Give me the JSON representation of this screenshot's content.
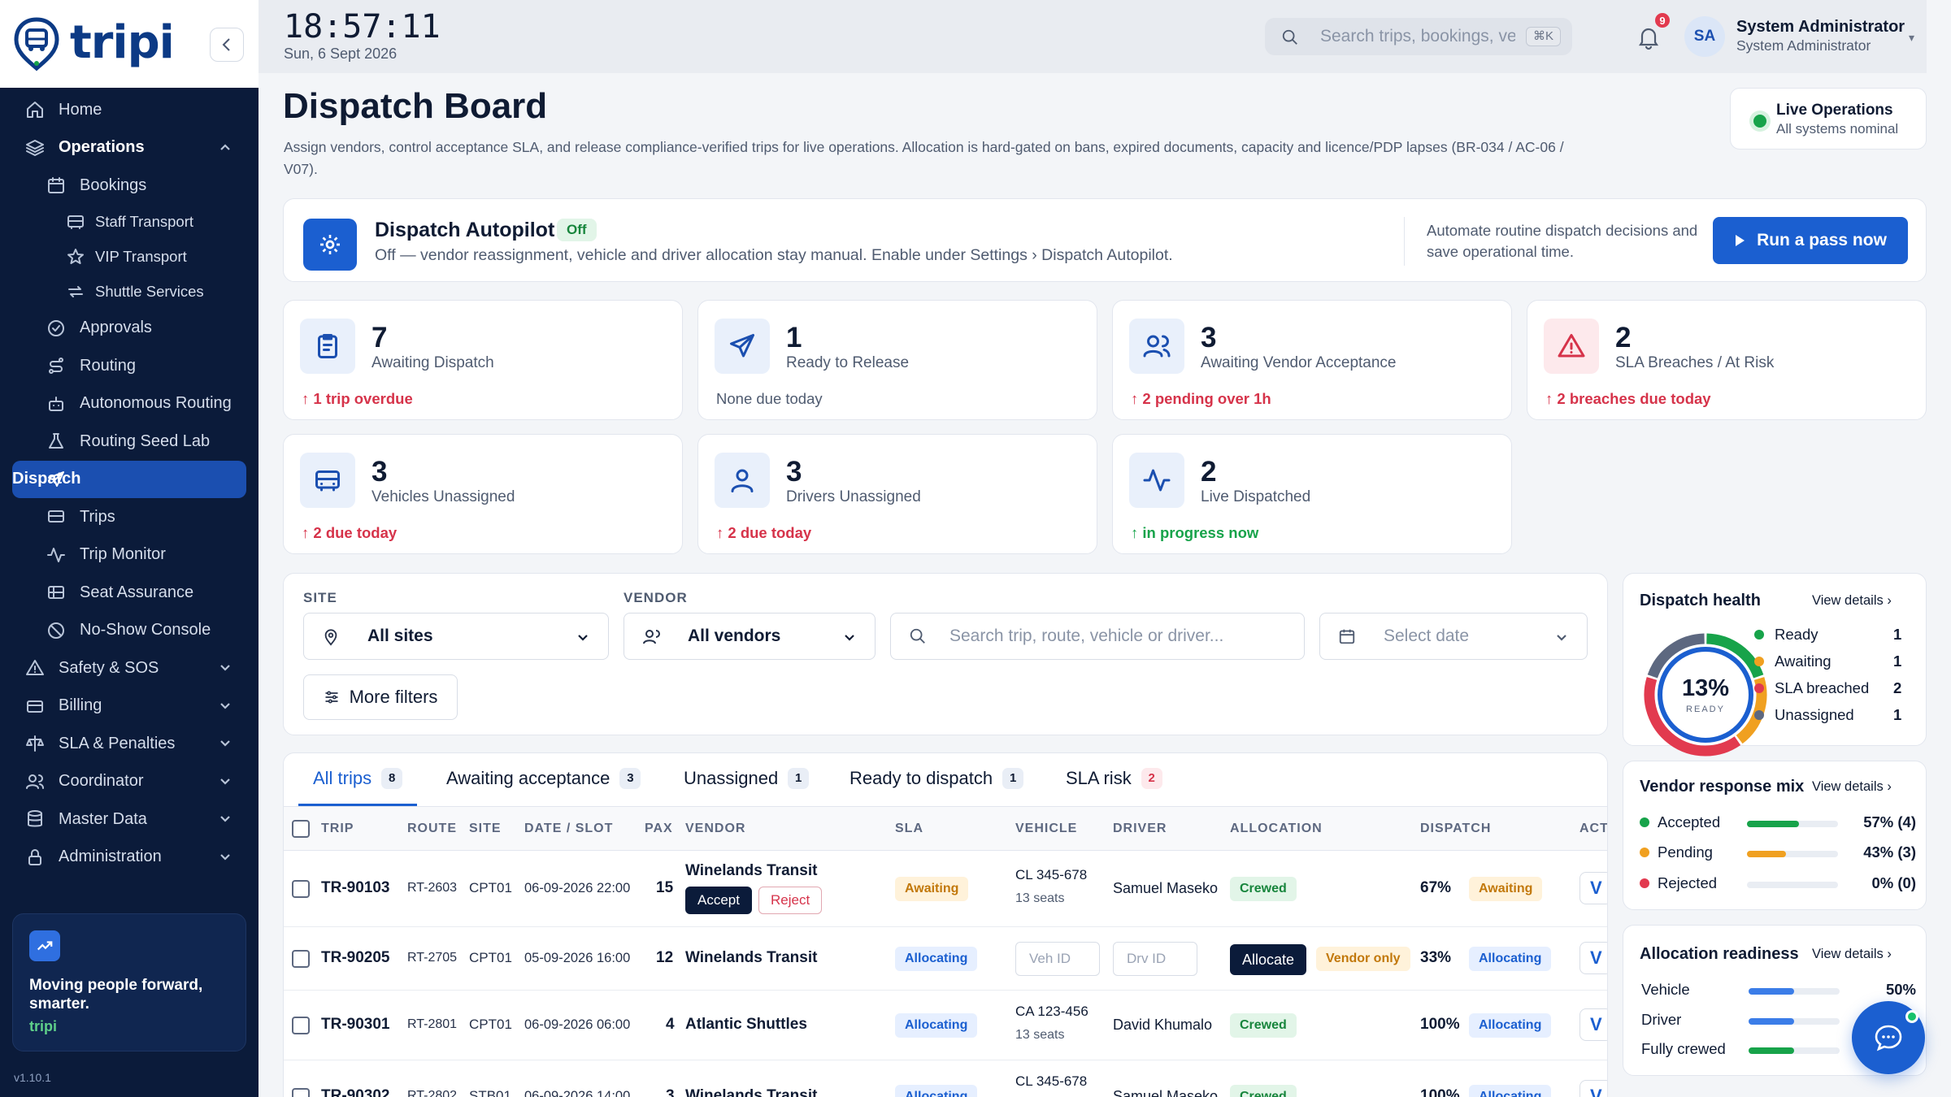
{
  "brand": {
    "name": "tripi"
  },
  "sidebar": {
    "items": [
      {
        "label": "Home",
        "icon": "home-icon"
      },
      {
        "label": "Operations",
        "icon": "layers-icon"
      },
      {
        "label": "Bookings",
        "icon": "calendar-icon"
      },
      {
        "label": "Staff Transport",
        "icon": "bus-icon"
      },
      {
        "label": "VIP Transport",
        "icon": "star-icon"
      },
      {
        "label": "Shuttle Services",
        "icon": "repeat-icon"
      },
      {
        "label": "Approvals",
        "icon": "check-circle-icon"
      },
      {
        "label": "Routing",
        "icon": "route-icon"
      },
      {
        "label": "Autonomous Routing",
        "icon": "robot-icon"
      },
      {
        "label": "Routing Seed Lab",
        "icon": "flask-icon"
      },
      {
        "label": "Dispatch",
        "icon": "send-icon"
      },
      {
        "label": "Trips",
        "icon": "bus-icon"
      },
      {
        "label": "Trip Monitor",
        "icon": "activity-icon"
      },
      {
        "label": "Seat Assurance",
        "icon": "seat-icon"
      },
      {
        "label": "No-Show Console",
        "icon": "ban-icon"
      },
      {
        "label": "Safety & SOS",
        "icon": "warning-icon"
      },
      {
        "label": "Billing",
        "icon": "credit-card-icon"
      },
      {
        "label": "SLA & Penalties",
        "icon": "scale-icon"
      },
      {
        "label": "Coordinator",
        "icon": "users-icon"
      },
      {
        "label": "Master Data",
        "icon": "database-icon"
      },
      {
        "label": "Administration",
        "icon": "lock-icon"
      }
    ],
    "promo": {
      "text": "Moving people forward, smarter.",
      "brand": "tripi"
    },
    "version": "v1.10.1"
  },
  "topbar": {
    "time": "18:57:11",
    "date": "Sun, 6 Sept 2026",
    "search_placeholder": "Search trips, bookings, vehicles",
    "shortcut": "⌘K",
    "notifications": "9",
    "avatar": "SA",
    "user_name": "System Administrator",
    "user_role": "System Administrator"
  },
  "page": {
    "title": "Dispatch Board",
    "subtitle": "Assign vendors, control acceptance SLA, and release compliance-verified trips for live operations. Allocation is hard-gated on bans, expired documents, capacity and licence/PDP lapses (BR-034 / AC-06 / V07).",
    "live_title": "Live Operations",
    "live_sub": "All systems nominal"
  },
  "autopilot": {
    "title": "Dispatch Autopilot",
    "badge": "Off",
    "sub": "Off — vendor reassignment, vehicle and driver allocation stay manual. Enable under Settings › Dispatch Autopilot.",
    "hint": "Automate routine dispatch decisions and save operational time.",
    "button": "Run a pass now"
  },
  "kpis": [
    {
      "value": "7",
      "label": "Awaiting Dispatch",
      "foot": "1 trip overdue",
      "tone": "red",
      "arrow": "↑",
      "icon": "clipboard-icon"
    },
    {
      "value": "1",
      "label": "Ready to Release",
      "foot": "None due today",
      "tone": "grey",
      "arrow": "",
      "icon": "send-icon"
    },
    {
      "value": "3",
      "label": "Awaiting Vendor Acceptance",
      "foot": "2 pending over 1h",
      "tone": "red",
      "arrow": "↑",
      "icon": "users-icon"
    },
    {
      "value": "2",
      "label": "SLA Breaches / At Risk",
      "foot": "2 breaches due today",
      "tone": "red",
      "arrow": "↑",
      "icon": "warning-icon"
    },
    {
      "value": "3",
      "label": "Vehicles Unassigned",
      "foot": "2 due today",
      "tone": "red",
      "arrow": "↑",
      "icon": "bus-icon"
    },
    {
      "value": "3",
      "label": "Drivers Unassigned",
      "foot": "2 due today",
      "tone": "red",
      "arrow": "↑",
      "icon": "user-icon"
    },
    {
      "value": "2",
      "label": "Live Dispatched",
      "foot": "in progress now",
      "tone": "green",
      "arrow": "↑",
      "icon": "activity-icon"
    }
  ],
  "filters": {
    "site_label": "SITE",
    "site_value": "All sites",
    "vendor_label": "VENDOR",
    "vendor_value": "All vendors",
    "search_placeholder": "Search trip, route, vehicle or driver...",
    "date_placeholder": "Select date",
    "more": "More filters"
  },
  "tabs": [
    {
      "label": "All trips",
      "count": "8"
    },
    {
      "label": "Awaiting acceptance",
      "count": "3"
    },
    {
      "label": "Unassigned",
      "count": "1"
    },
    {
      "label": "Ready to dispatch",
      "count": "1"
    },
    {
      "label": "SLA risk",
      "count": "2"
    }
  ],
  "table": {
    "headers": [
      "TRIP",
      "ROUTE",
      "SITE",
      "DATE / SLOT",
      "PAX",
      "VENDOR",
      "SLA",
      "VEHICLE",
      "DRIVER",
      "ALLOCATION",
      "DISPATCH",
      "ACT"
    ],
    "accept": "Accept",
    "reject": "Reject",
    "allocate": "Allocate",
    "veh_placeholder": "Veh ID",
    "drv_placeholder": "Drv ID",
    "rows": [
      {
        "trip": "TR-90103",
        "route": "RT-2603",
        "site": "CPT01",
        "slot": "06-09-2026 22:00",
        "pax": "15",
        "vendor": "Winelands Transit",
        "sla": "Awaiting",
        "vehicle": "CL 345-678",
        "seats": "13 seats",
        "driver": "Samuel Maseko",
        "allocation": "Crewed",
        "pct": "67%",
        "dispatch": "Awaiting"
      },
      {
        "trip": "TR-90205",
        "route": "RT-2705",
        "site": "CPT01",
        "slot": "05-09-2026 16:00",
        "pax": "12",
        "vendor": "Winelands Transit",
        "sla": "Allocating",
        "vehicle": "",
        "seats": "",
        "driver": "",
        "allocation": "Vendor only",
        "pct": "33%",
        "dispatch": "Allocating"
      },
      {
        "trip": "TR-90301",
        "route": "RT-2801",
        "site": "CPT01",
        "slot": "06-09-2026 06:00",
        "pax": "4",
        "vendor": "Atlantic Shuttles",
        "sla": "Allocating",
        "vehicle": "CA 123-456",
        "seats": "13 seats",
        "driver": "David Khumalo",
        "allocation": "Crewed",
        "pct": "100%",
        "dispatch": "Allocating"
      },
      {
        "trip": "TR-90302",
        "route": "RT-2802",
        "site": "STB01",
        "slot": "06-09-2026 14:00",
        "pax": "3",
        "vendor": "Winelands Transit",
        "sla": "Allocating",
        "vehicle": "CL 345-678",
        "seats": "",
        "driver": "Samuel Maseko",
        "allocation": "Crewed",
        "pct": "100%",
        "dispatch": "Allocating"
      }
    ],
    "action_glyph": "V"
  },
  "health": {
    "title": "Dispatch health",
    "link": "View details",
    "pct": "13%",
    "pct_label": "READY",
    "legend": [
      {
        "label": "Ready",
        "value": "1",
        "color": "#17a34a"
      },
      {
        "label": "Awaiting",
        "value": "1",
        "color": "#f0a020"
      },
      {
        "label": "SLA breached",
        "value": "2",
        "color": "#e23a4f"
      },
      {
        "label": "Unassigned",
        "value": "1",
        "color": "#5d6880"
      }
    ],
    "segments": [
      1,
      1,
      2,
      1
    ]
  },
  "vendor_mix": {
    "title": "Vendor response mix",
    "link": "View details",
    "rows": [
      {
        "label": "Accepted",
        "value": "57% (4)",
        "fraction": 0.57,
        "color": "#17a34a"
      },
      {
        "label": "Pending",
        "value": "43% (3)",
        "fraction": 0.43,
        "color": "#f0a020"
      },
      {
        "label": "Rejected",
        "value": "0% (0)",
        "fraction": 0,
        "color": "#e23a4f"
      }
    ]
  },
  "readiness": {
    "title": "Allocation readiness",
    "link": "View details",
    "rows": [
      {
        "label": "Vehicle",
        "value": "50%",
        "fraction": 0.5,
        "color": "#3b7de8"
      },
      {
        "label": "Driver",
        "value": "",
        "fraction": 0.5,
        "color": "#3b7de8"
      },
      {
        "label": "Fully crewed",
        "value": "",
        "fraction": 0.5,
        "color": "#17a34a"
      }
    ]
  },
  "colors": {
    "brand": "#1b5fd0",
    "sidebar": "#0b1b3a",
    "danger": "#d6334a",
    "success": "#17a34a",
    "warning": "#c2780a"
  }
}
